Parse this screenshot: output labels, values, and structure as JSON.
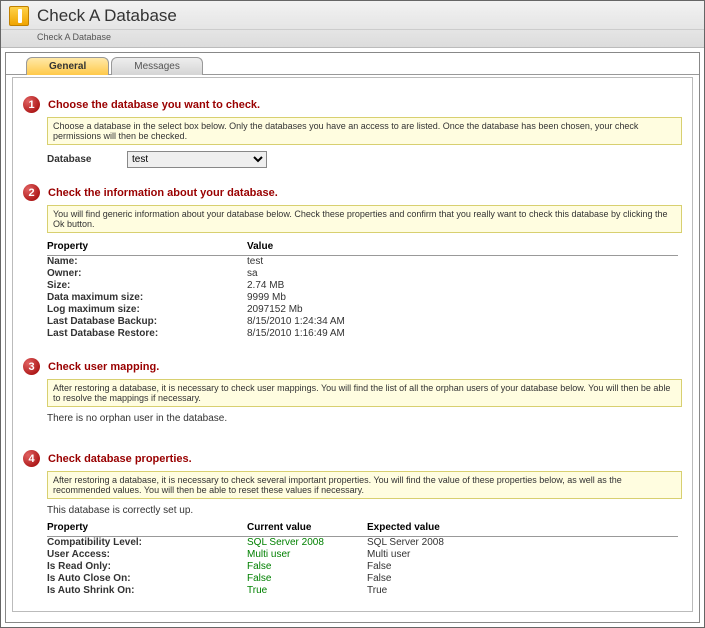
{
  "window": {
    "title": "Check A Database",
    "subtitle": "Check A Database"
  },
  "tabs": {
    "general": "General",
    "messages": "Messages"
  },
  "step1": {
    "num": "1",
    "title": "Choose the database you want to check.",
    "info": "Choose a database in the select box below. Only the databases you have an access to are listed. Once the database has been chosen, your check permissions will then be checked.",
    "db_label": "Database",
    "db_value": "test"
  },
  "step2": {
    "num": "2",
    "title": "Check the information about your database.",
    "info": "You will find generic information about your database below. Check these properties and confirm that you really want to check this database by clicking the Ok button.",
    "col_prop": "Property",
    "col_val": "Value",
    "rows": {
      "name": {
        "p": "Name:",
        "v": "test"
      },
      "owner": {
        "p": "Owner:",
        "v": "sa"
      },
      "size": {
        "p": "Size:",
        "v": "2.74 MB"
      },
      "dmax": {
        "p": "Data maximum size:",
        "v": "9999 Mb"
      },
      "lmax": {
        "p": "Log maximum size:",
        "v": "2097152 Mb"
      },
      "backup": {
        "p": "Last Database Backup:",
        "v": "8/15/2010 1:24:34 AM"
      },
      "restore": {
        "p": "Last Database Restore:",
        "v": "8/15/2010 1:16:49 AM"
      }
    }
  },
  "step3": {
    "num": "3",
    "title": "Check user mapping.",
    "info": "After restoring a database, it is necessary to check user mappings. You will find the list of all the orphan users of your database below. You will then be able to resolve the mappings if necessary.",
    "note": "There is no orphan user in the database."
  },
  "step4": {
    "num": "4",
    "title": "Check database properties.",
    "info": "After restoring a database, it is necessary to check several important properties. You will find the value of these properties below, as well as the recommended values. You will then be able to reset these values if necessary.",
    "note": "This database is correctly set up.",
    "col_prop": "Property",
    "col_cur": "Current value",
    "col_exp": "Expected value",
    "rows": {
      "compat": {
        "p": "Compatibility Level:",
        "c": "SQL Server 2008",
        "e": "SQL Server 2008"
      },
      "access": {
        "p": "User Access:",
        "c": "Multi user",
        "e": "Multi user"
      },
      "readonly": {
        "p": "Is Read Only:",
        "c": "False",
        "e": "False"
      },
      "autoclose": {
        "p": "Is Auto Close On:",
        "c": "False",
        "e": "False"
      },
      "autoshrink": {
        "p": "Is Auto Shrink On:",
        "c": "True",
        "e": "True"
      }
    }
  }
}
